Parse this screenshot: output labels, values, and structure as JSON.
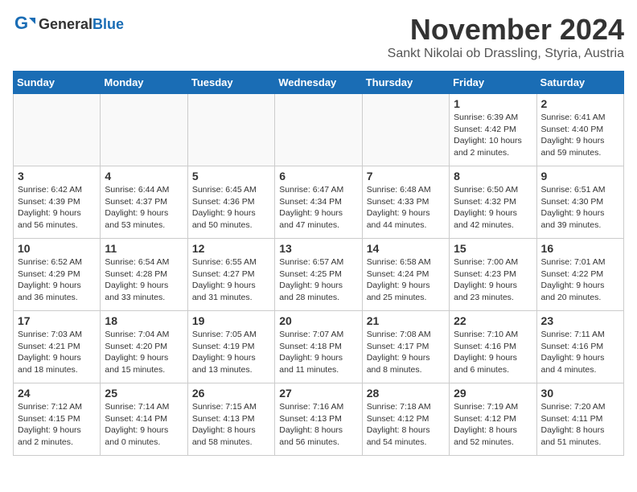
{
  "logo": {
    "general": "General",
    "blue": "Blue"
  },
  "header": {
    "month": "November 2024",
    "location": "Sankt Nikolai ob Drassling, Styria, Austria"
  },
  "weekdays": [
    "Sunday",
    "Monday",
    "Tuesday",
    "Wednesday",
    "Thursday",
    "Friday",
    "Saturday"
  ],
  "weeks": [
    [
      {
        "day": "",
        "info": ""
      },
      {
        "day": "",
        "info": ""
      },
      {
        "day": "",
        "info": ""
      },
      {
        "day": "",
        "info": ""
      },
      {
        "day": "",
        "info": ""
      },
      {
        "day": "1",
        "info": "Sunrise: 6:39 AM\nSunset: 4:42 PM\nDaylight: 10 hours\nand 2 minutes."
      },
      {
        "day": "2",
        "info": "Sunrise: 6:41 AM\nSunset: 4:40 PM\nDaylight: 9 hours\nand 59 minutes."
      }
    ],
    [
      {
        "day": "3",
        "info": "Sunrise: 6:42 AM\nSunset: 4:39 PM\nDaylight: 9 hours\nand 56 minutes."
      },
      {
        "day": "4",
        "info": "Sunrise: 6:44 AM\nSunset: 4:37 PM\nDaylight: 9 hours\nand 53 minutes."
      },
      {
        "day": "5",
        "info": "Sunrise: 6:45 AM\nSunset: 4:36 PM\nDaylight: 9 hours\nand 50 minutes."
      },
      {
        "day": "6",
        "info": "Sunrise: 6:47 AM\nSunset: 4:34 PM\nDaylight: 9 hours\nand 47 minutes."
      },
      {
        "day": "7",
        "info": "Sunrise: 6:48 AM\nSunset: 4:33 PM\nDaylight: 9 hours\nand 44 minutes."
      },
      {
        "day": "8",
        "info": "Sunrise: 6:50 AM\nSunset: 4:32 PM\nDaylight: 9 hours\nand 42 minutes."
      },
      {
        "day": "9",
        "info": "Sunrise: 6:51 AM\nSunset: 4:30 PM\nDaylight: 9 hours\nand 39 minutes."
      }
    ],
    [
      {
        "day": "10",
        "info": "Sunrise: 6:52 AM\nSunset: 4:29 PM\nDaylight: 9 hours\nand 36 minutes."
      },
      {
        "day": "11",
        "info": "Sunrise: 6:54 AM\nSunset: 4:28 PM\nDaylight: 9 hours\nand 33 minutes."
      },
      {
        "day": "12",
        "info": "Sunrise: 6:55 AM\nSunset: 4:27 PM\nDaylight: 9 hours\nand 31 minutes."
      },
      {
        "day": "13",
        "info": "Sunrise: 6:57 AM\nSunset: 4:25 PM\nDaylight: 9 hours\nand 28 minutes."
      },
      {
        "day": "14",
        "info": "Sunrise: 6:58 AM\nSunset: 4:24 PM\nDaylight: 9 hours\nand 25 minutes."
      },
      {
        "day": "15",
        "info": "Sunrise: 7:00 AM\nSunset: 4:23 PM\nDaylight: 9 hours\nand 23 minutes."
      },
      {
        "day": "16",
        "info": "Sunrise: 7:01 AM\nSunset: 4:22 PM\nDaylight: 9 hours\nand 20 minutes."
      }
    ],
    [
      {
        "day": "17",
        "info": "Sunrise: 7:03 AM\nSunset: 4:21 PM\nDaylight: 9 hours\nand 18 minutes."
      },
      {
        "day": "18",
        "info": "Sunrise: 7:04 AM\nSunset: 4:20 PM\nDaylight: 9 hours\nand 15 minutes."
      },
      {
        "day": "19",
        "info": "Sunrise: 7:05 AM\nSunset: 4:19 PM\nDaylight: 9 hours\nand 13 minutes."
      },
      {
        "day": "20",
        "info": "Sunrise: 7:07 AM\nSunset: 4:18 PM\nDaylight: 9 hours\nand 11 minutes."
      },
      {
        "day": "21",
        "info": "Sunrise: 7:08 AM\nSunset: 4:17 PM\nDaylight: 9 hours\nand 8 minutes."
      },
      {
        "day": "22",
        "info": "Sunrise: 7:10 AM\nSunset: 4:16 PM\nDaylight: 9 hours\nand 6 minutes."
      },
      {
        "day": "23",
        "info": "Sunrise: 7:11 AM\nSunset: 4:16 PM\nDaylight: 9 hours\nand 4 minutes."
      }
    ],
    [
      {
        "day": "24",
        "info": "Sunrise: 7:12 AM\nSunset: 4:15 PM\nDaylight: 9 hours\nand 2 minutes."
      },
      {
        "day": "25",
        "info": "Sunrise: 7:14 AM\nSunset: 4:14 PM\nDaylight: 9 hours\nand 0 minutes."
      },
      {
        "day": "26",
        "info": "Sunrise: 7:15 AM\nSunset: 4:13 PM\nDaylight: 8 hours\nand 58 minutes."
      },
      {
        "day": "27",
        "info": "Sunrise: 7:16 AM\nSunset: 4:13 PM\nDaylight: 8 hours\nand 56 minutes."
      },
      {
        "day": "28",
        "info": "Sunrise: 7:18 AM\nSunset: 4:12 PM\nDaylight: 8 hours\nand 54 minutes."
      },
      {
        "day": "29",
        "info": "Sunrise: 7:19 AM\nSunset: 4:12 PM\nDaylight: 8 hours\nand 52 minutes."
      },
      {
        "day": "30",
        "info": "Sunrise: 7:20 AM\nSunset: 4:11 PM\nDaylight: 8 hours\nand 51 minutes."
      }
    ]
  ]
}
